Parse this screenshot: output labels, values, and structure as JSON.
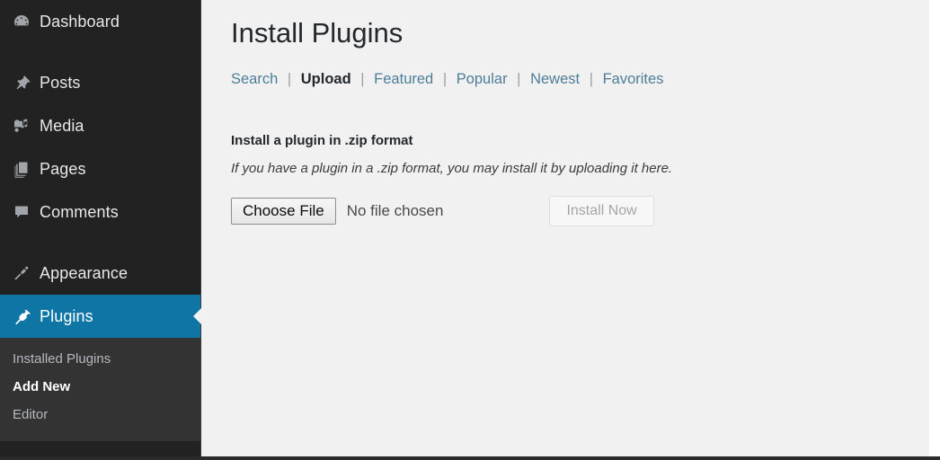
{
  "sidebar": {
    "items": [
      {
        "label": "Dashboard",
        "icon": "dashboard-gauge-icon",
        "current": false
      },
      {
        "label": "Posts",
        "icon": "pin-icon",
        "current": false
      },
      {
        "label": "Media",
        "icon": "camera-music-icon",
        "current": false
      },
      {
        "label": "Pages",
        "icon": "pages-stack-icon",
        "current": false
      },
      {
        "label": "Comments",
        "icon": "comment-bubble-icon",
        "current": false
      },
      {
        "label": "Appearance",
        "icon": "paintbrush-icon",
        "current": false
      },
      {
        "label": "Plugins",
        "icon": "plug-icon",
        "current": true
      }
    ],
    "submenu": [
      {
        "label": "Installed Plugins",
        "current": false
      },
      {
        "label": "Add New",
        "current": true
      },
      {
        "label": "Editor",
        "current": false
      }
    ]
  },
  "main": {
    "title": "Install Plugins",
    "filter_links": [
      {
        "label": "Search",
        "current": false
      },
      {
        "label": "Upload",
        "current": true
      },
      {
        "label": "Featured",
        "current": false
      },
      {
        "label": "Popular",
        "current": false
      },
      {
        "label": "Newest",
        "current": false
      },
      {
        "label": "Favorites",
        "current": false
      }
    ],
    "separator": "|",
    "upload": {
      "heading": "Install a plugin in .zip format",
      "description": "If you have a plugin in a .zip format, you may install it by uploading it here.",
      "choose_file_label": "Choose File",
      "file_status": "No file chosen",
      "install_button_label": "Install Now"
    }
  },
  "colors": {
    "sidebar_bg": "#222223",
    "submenu_bg": "#333334",
    "current_menu_bg": "#0e75a4",
    "content_bg": "#f1f1f1",
    "link": "#4d7e98",
    "heading": "#23282d"
  }
}
